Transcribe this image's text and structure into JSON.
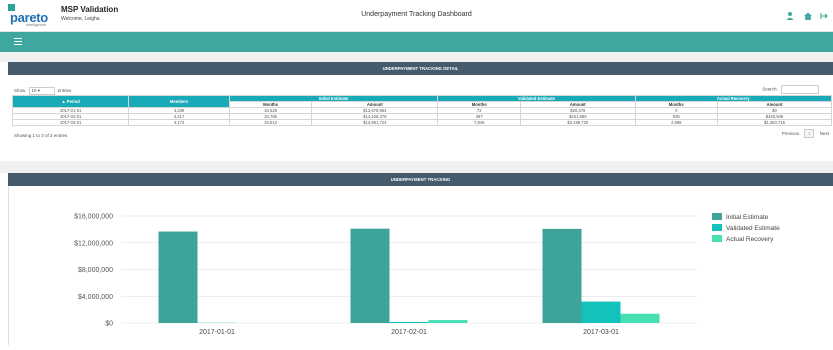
{
  "header": {
    "app_name": "MSP Validation",
    "welcome": "Welcome, Leigha",
    "logo_word": "pareto",
    "logo_sub": "intelligence",
    "page_title": "Underpayment Tracking Dashboard",
    "icons": [
      "user-icon",
      "home-icon",
      "logout-icon"
    ]
  },
  "nav": {
    "menu_icon": "hamburger-icon",
    "color": "#3ea89e"
  },
  "detail": {
    "title": "UNDERPAYMENT TRACKING DETAIL",
    "show_label": "Show",
    "show_value": "10",
    "entries_label": "entries",
    "search_label": "Search:",
    "search_value": "",
    "groups": [
      "Initial Estimate",
      "Validated Estimate",
      "Actual Recovery"
    ],
    "col_period": "▲ Period",
    "col_members": "Members",
    "sub_months": "Months",
    "sub_amount": "Amount",
    "rows": [
      [
        "2017-01-01",
        "3,239",
        "33,528",
        "$13,676,964",
        "72",
        "$29,378",
        "0",
        "$0"
      ],
      [
        "2017-02-01",
        "3,217",
        "34,785",
        "$14,106,379",
        "397",
        "$161,889",
        "935",
        "$440,948"
      ],
      [
        "2017-03-01",
        "3,173",
        "34,512",
        "$14,681,724",
        "7,845",
        "$3,198,720",
        "2,889",
        "$1,383,715"
      ]
    ],
    "showing": "Showing 1 to 3 of 3 entries",
    "previous": "Previous",
    "page": "1",
    "next": "Next"
  },
  "tracking": {
    "title": "UNDERPAYMENT TRACKING",
    "chart_data": {
      "type": "bar",
      "categories": [
        "2017-01-01",
        "2017-02-01",
        "2017-03-01"
      ],
      "series": [
        {
          "name": "Initial Estimate",
          "values": [
            13676964,
            14106379,
            14081724
          ],
          "color": "#3ea39a"
        },
        {
          "name": "Validated Estimate",
          "values": [
            29378,
            161889,
            3198720
          ],
          "color": "#14c2bc"
        },
        {
          "name": "Actual Recovery",
          "values": [
            0,
            440948,
            1383715
          ],
          "color": "#47e0b2"
        }
      ],
      "yticks": [
        "$0",
        "$4,000,000",
        "$8,000,000",
        "$12,000,000",
        "$16,000,000"
      ],
      "ylim": [
        0,
        16000000
      ],
      "legend": "right",
      "grid": true
    }
  }
}
